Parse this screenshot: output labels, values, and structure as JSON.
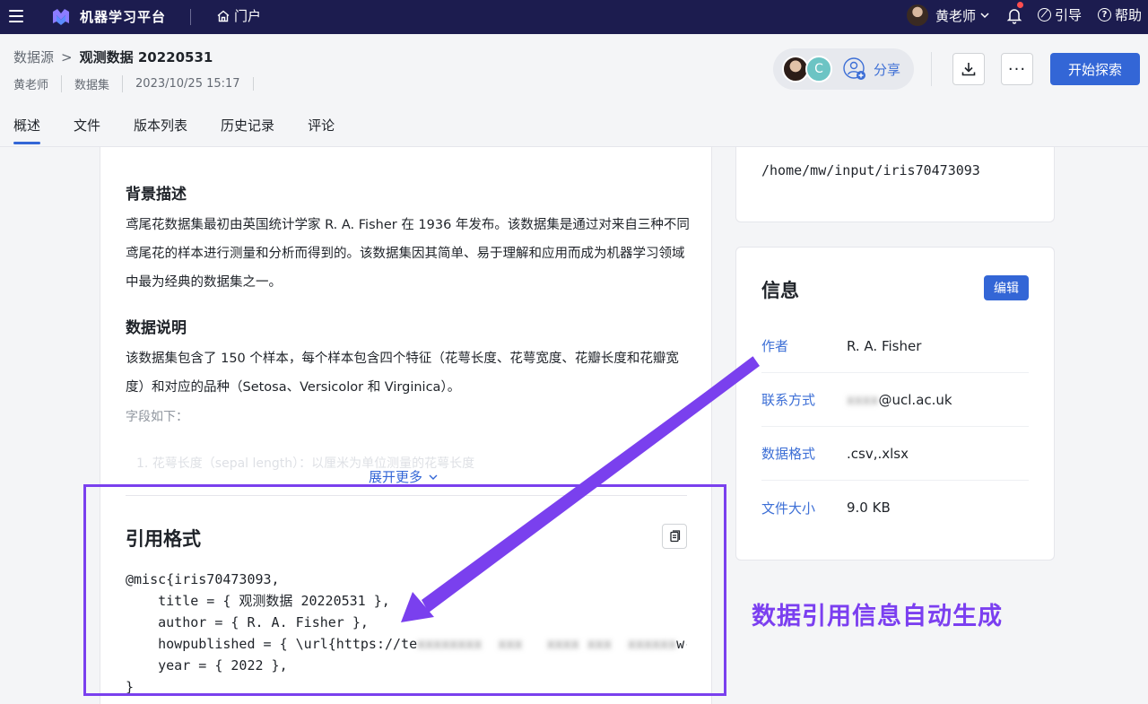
{
  "topbar": {
    "app_name": "机器学习平台",
    "portal_label": "门户",
    "user_name": "黄老师",
    "guide_label": "引导",
    "help_label": "帮助"
  },
  "breadcrumb": {
    "root": "数据源",
    "separator": ">",
    "current": "观测数据 20220531"
  },
  "meta": {
    "owner": "黄老师",
    "type": "数据集",
    "timestamp": "2023/10/25 15:17"
  },
  "header": {
    "avatar_letter": "C",
    "share_label": "分享",
    "more_label": "···",
    "explore_label": "开始探索"
  },
  "tabs": [
    {
      "label": "概述",
      "active": true
    },
    {
      "label": "文件"
    },
    {
      "label": "版本列表"
    },
    {
      "label": "历史记录"
    },
    {
      "label": "评论"
    }
  ],
  "content": {
    "background_title": "背景描述",
    "background_text": "鸢尾花数据集最初由英国统计学家 R. A. Fisher 在 1936 年发布。该数据集是通过对来自三种不同鸢尾花的样本进行测量和分析而得到的。该数据集因其简单、易于理解和应用而成为机器学习领域中最为经典的数据集之一。",
    "description_title": "数据说明",
    "description_text": "该数据集包含了 150 个样本，每个样本包含四个特征（花萼长度、花萼宽度、花瓣长度和花瓣宽度）和对应的品种（Setosa、Versicolor 和 Virginica）。",
    "fields_label": "字段如下：",
    "faded_item": "1. 花萼长度（sepal length）：以厘米为单位测量的花萼长度",
    "expand_label": "展开更多"
  },
  "citation": {
    "title": "引用格式",
    "line1": "@misc{iris70473093,",
    "line2": "    title = { 观测数据 20220531 },",
    "line3": "    author = { R. A. Fisher },",
    "line4_prefix": "    howpublished = { \\url{https://te",
    "line4_redacted": "xxxxxxxx  xxx   xxxx xxx  xxxxxx",
    "line4_suffix": "w-",
    "line5": "    year = { 2022 },",
    "line6": "}"
  },
  "path": {
    "value": "/home/mw/input/iris70473093"
  },
  "info": {
    "title": "信息",
    "edit_label": "编辑",
    "rows": [
      {
        "key": "作者",
        "value": "R. A. Fisher"
      },
      {
        "key": "联系方式",
        "value_redacted": "xxxx",
        "value": "@ucl.ac.uk"
      },
      {
        "key": "数据格式",
        "value": ".csv,.xlsx"
      },
      {
        "key": "文件大小",
        "value": "9.0 KB"
      }
    ]
  },
  "annotation": {
    "callout": "数据引用信息自动生成",
    "color": "#7a40ee"
  },
  "colors": {
    "topbar": "#1c1c4f",
    "primary": "#3366d6",
    "accent_purple": "#7b3ff0"
  }
}
